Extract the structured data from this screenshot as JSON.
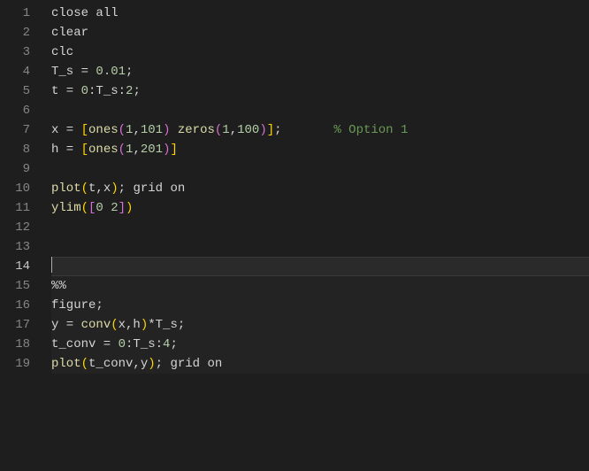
{
  "editor": {
    "current_line": 14,
    "lines": [
      {
        "num": 1,
        "tokens": [
          {
            "t": "close all",
            "c": "tk-default"
          }
        ]
      },
      {
        "num": 2,
        "tokens": [
          {
            "t": "clear",
            "c": "tk-default"
          }
        ]
      },
      {
        "num": 3,
        "tokens": [
          {
            "t": "clc",
            "c": "tk-default"
          }
        ]
      },
      {
        "num": 4,
        "tokens": [
          {
            "t": "T_s = ",
            "c": "tk-default"
          },
          {
            "t": "0.01",
            "c": "tk-num"
          },
          {
            "t": ";",
            "c": "tk-default"
          }
        ]
      },
      {
        "num": 5,
        "tokens": [
          {
            "t": "t = ",
            "c": "tk-default"
          },
          {
            "t": "0",
            "c": "tk-num"
          },
          {
            "t": ":T_s:",
            "c": "tk-default"
          },
          {
            "t": "2",
            "c": "tk-num"
          },
          {
            "t": ";",
            "c": "tk-default"
          }
        ]
      },
      {
        "num": 6,
        "tokens": []
      },
      {
        "num": 7,
        "tokens": [
          {
            "t": "x = ",
            "c": "tk-default"
          },
          {
            "t": "[",
            "c": "tk-bracket"
          },
          {
            "t": "ones",
            "c": "tk-func"
          },
          {
            "t": "(",
            "c": "tk-paren2"
          },
          {
            "t": "1",
            "c": "tk-num"
          },
          {
            "t": ",",
            "c": "tk-default"
          },
          {
            "t": "101",
            "c": "tk-num"
          },
          {
            "t": ")",
            "c": "tk-paren2"
          },
          {
            "t": " ",
            "c": "tk-default"
          },
          {
            "t": "zeros",
            "c": "tk-func"
          },
          {
            "t": "(",
            "c": "tk-paren2"
          },
          {
            "t": "1",
            "c": "tk-num"
          },
          {
            "t": ",",
            "c": "tk-default"
          },
          {
            "t": "100",
            "c": "tk-num"
          },
          {
            "t": ")",
            "c": "tk-paren2"
          },
          {
            "t": "]",
            "c": "tk-bracket"
          },
          {
            "t": ";       ",
            "c": "tk-default"
          },
          {
            "t": "% Option 1",
            "c": "tk-comment"
          }
        ]
      },
      {
        "num": 8,
        "tokens": [
          {
            "t": "h = ",
            "c": "tk-default"
          },
          {
            "t": "[",
            "c": "tk-bracket"
          },
          {
            "t": "ones",
            "c": "tk-func"
          },
          {
            "t": "(",
            "c": "tk-paren2"
          },
          {
            "t": "1",
            "c": "tk-num"
          },
          {
            "t": ",",
            "c": "tk-default"
          },
          {
            "t": "201",
            "c": "tk-num"
          },
          {
            "t": ")",
            "c": "tk-paren2"
          },
          {
            "t": "]",
            "c": "tk-bracket"
          }
        ]
      },
      {
        "num": 9,
        "tokens": []
      },
      {
        "num": 10,
        "tokens": [
          {
            "t": "plot",
            "c": "tk-func"
          },
          {
            "t": "(",
            "c": "tk-paren"
          },
          {
            "t": "t,x",
            "c": "tk-default"
          },
          {
            "t": ")",
            "c": "tk-paren"
          },
          {
            "t": "; grid on",
            "c": "tk-default"
          }
        ]
      },
      {
        "num": 11,
        "tokens": [
          {
            "t": "ylim",
            "c": "tk-func"
          },
          {
            "t": "(",
            "c": "tk-paren"
          },
          {
            "t": "[",
            "c": "tk-paren2"
          },
          {
            "t": "0",
            "c": "tk-num"
          },
          {
            "t": " ",
            "c": "tk-default"
          },
          {
            "t": "2",
            "c": "tk-num"
          },
          {
            "t": "]",
            "c": "tk-paren2"
          },
          {
            "t": ")",
            "c": "tk-paren"
          }
        ]
      },
      {
        "num": 12,
        "tokens": []
      },
      {
        "num": 13,
        "tokens": []
      },
      {
        "num": 14,
        "tokens": [],
        "current": true
      },
      {
        "num": 15,
        "tokens": [
          {
            "t": "%%",
            "c": "tk-default"
          }
        ],
        "section": true
      },
      {
        "num": 16,
        "tokens": [
          {
            "t": "figure;",
            "c": "tk-default"
          }
        ],
        "section": true
      },
      {
        "num": 17,
        "tokens": [
          {
            "t": "y = ",
            "c": "tk-default"
          },
          {
            "t": "conv",
            "c": "tk-func"
          },
          {
            "t": "(",
            "c": "tk-paren"
          },
          {
            "t": "x,h",
            "c": "tk-default"
          },
          {
            "t": ")",
            "c": "tk-paren"
          },
          {
            "t": "*T_s;",
            "c": "tk-default"
          }
        ],
        "section": true
      },
      {
        "num": 18,
        "tokens": [
          {
            "t": "t_conv = ",
            "c": "tk-default"
          },
          {
            "t": "0",
            "c": "tk-num"
          },
          {
            "t": ":T_s:",
            "c": "tk-default"
          },
          {
            "t": "4",
            "c": "tk-num"
          },
          {
            "t": ";",
            "c": "tk-default"
          }
        ],
        "section": true
      },
      {
        "num": 19,
        "tokens": [
          {
            "t": "plot",
            "c": "tk-func"
          },
          {
            "t": "(",
            "c": "tk-paren"
          },
          {
            "t": "t_conv,y",
            "c": "tk-default"
          },
          {
            "t": ")",
            "c": "tk-paren"
          },
          {
            "t": "; grid on",
            "c": "tk-default"
          }
        ],
        "section": true
      }
    ]
  }
}
